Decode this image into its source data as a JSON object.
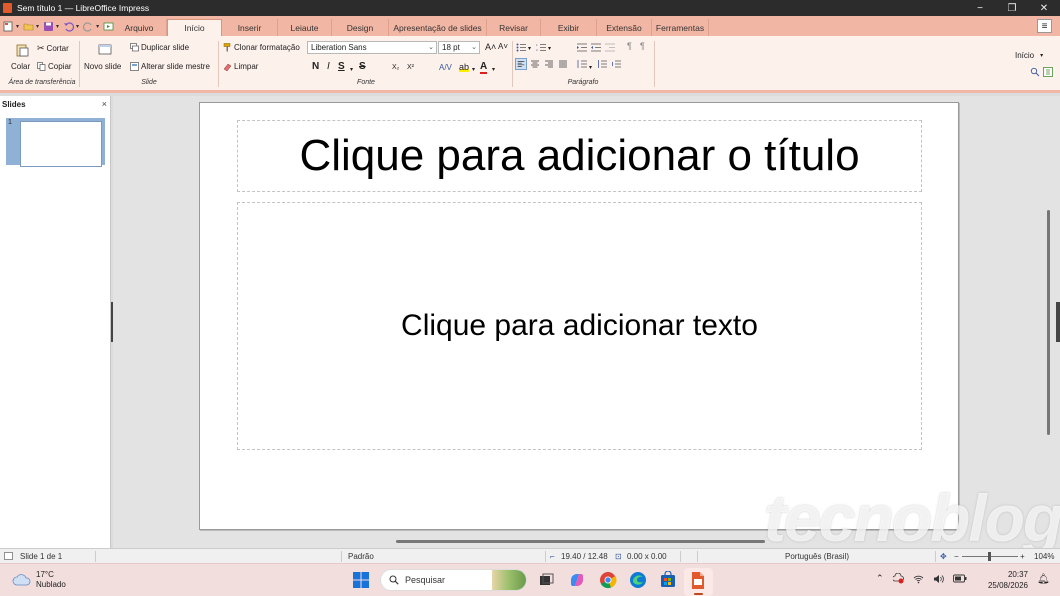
{
  "window": {
    "title": "Sem título 1 — LibreOffice Impress",
    "controls": {
      "minimize": "−",
      "maximize": "❐",
      "close": "✕"
    }
  },
  "menu_tabs": [
    {
      "label": "Arquivo",
      "active": false
    },
    {
      "label": "Início",
      "active": true
    },
    {
      "label": "Inserir",
      "active": false
    },
    {
      "label": "Leiaute",
      "active": false
    },
    {
      "label": "Design",
      "active": false
    },
    {
      "label": "Apresentação de slides",
      "active": false
    },
    {
      "label": "Revisar",
      "active": false
    },
    {
      "label": "Exibir",
      "active": false
    },
    {
      "label": "Extensão",
      "active": false
    },
    {
      "label": "Ferramentas",
      "active": false
    }
  ],
  "ribbon": {
    "clipboard": {
      "paste": "Colar",
      "cut": "Cortar",
      "copy": "Copiar",
      "group_label": "Área de transferência"
    },
    "slide": {
      "new_slide": "Novo slide",
      "duplicate": "Duplicar slide",
      "change_master": "Alterar slide mestre",
      "group_label": "Slide"
    },
    "font": {
      "clone_formatting": "Clonar formatação",
      "clear": "Limpar",
      "font_name": "Liberation Sans",
      "font_size": "18 pt",
      "bold": "N",
      "italic": "I",
      "underline": "S",
      "strikethrough": "S",
      "group_label": "Fonte"
    },
    "paragraph": {
      "group_label": "Parágrafo"
    },
    "right_dropdown": "Início"
  },
  "slides_pane": {
    "title": "Slides",
    "close": "×",
    "thumbnails": [
      {
        "number": "1"
      }
    ]
  },
  "slide": {
    "title_placeholder": "Clique para adicionar o título",
    "body_placeholder": "Clique para adicionar texto"
  },
  "watermark": "tecnoblog",
  "statusbar": {
    "slide_info": "Slide 1 de 1",
    "master": "Padrão",
    "position": "19.40 / 12.48",
    "size": "0.00 x 0.00",
    "language": "Português (Brasil)",
    "zoom": "104%"
  },
  "taskbar": {
    "weather_temp": "17°C",
    "weather_desc": "Nublado",
    "search_placeholder": "Pesquisar",
    "time": "20:37",
    "date": "25/08/2026"
  },
  "colors": {
    "accent": "#f2b7a4",
    "ribbon_bg": "#fdf1ec",
    "titlebar": "#2c2c2c",
    "taskbar": "#f3dede",
    "slide_selection": "#8fb1d6"
  }
}
